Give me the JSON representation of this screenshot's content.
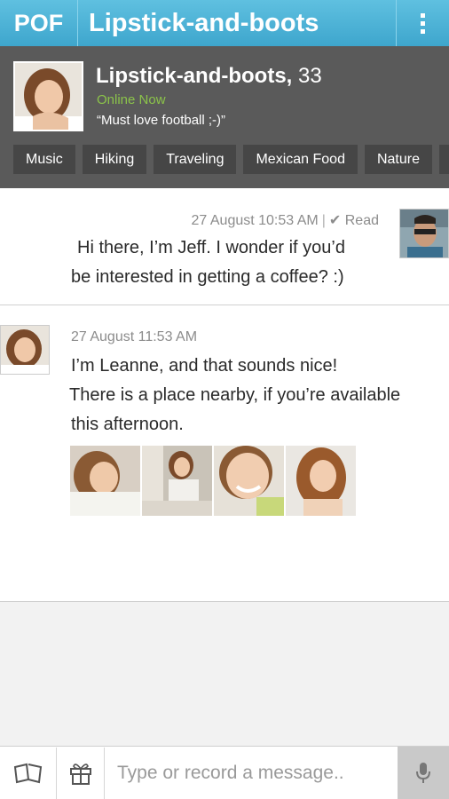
{
  "app": {
    "logo": "POF",
    "title": "Lipstick-and-boots"
  },
  "profile": {
    "username": "Lipstick-and-boots,",
    "age": "33",
    "status": "Online Now",
    "headline": "“Must love football ;-)”",
    "interests": [
      "Music",
      "Hiking",
      "Traveling",
      "Mexican Food",
      "Nature"
    ]
  },
  "messages": [
    {
      "timestamp": "27 August 10:53 AM",
      "read_status": "✔ Read",
      "lines": [
        "Hi there, I’m Jeff. I wonder if you’d",
        "be interested in getting a coffee? :)"
      ]
    },
    {
      "timestamp": "27 August 11:53 AM",
      "lines": [
        "I’m Leanne, and that sounds nice!",
        "There is a place nearby, if you’re available",
        "this afternoon."
      ]
    }
  ],
  "composer": {
    "placeholder": "Type or record a message.."
  },
  "colors": {
    "accent": "#3ea6cd",
    "online": "#8bc34a",
    "header_bg": "#5a5a5a"
  },
  "icons": [
    "menu-icon",
    "stickers-icon",
    "gift-icon",
    "microphone-icon"
  ]
}
